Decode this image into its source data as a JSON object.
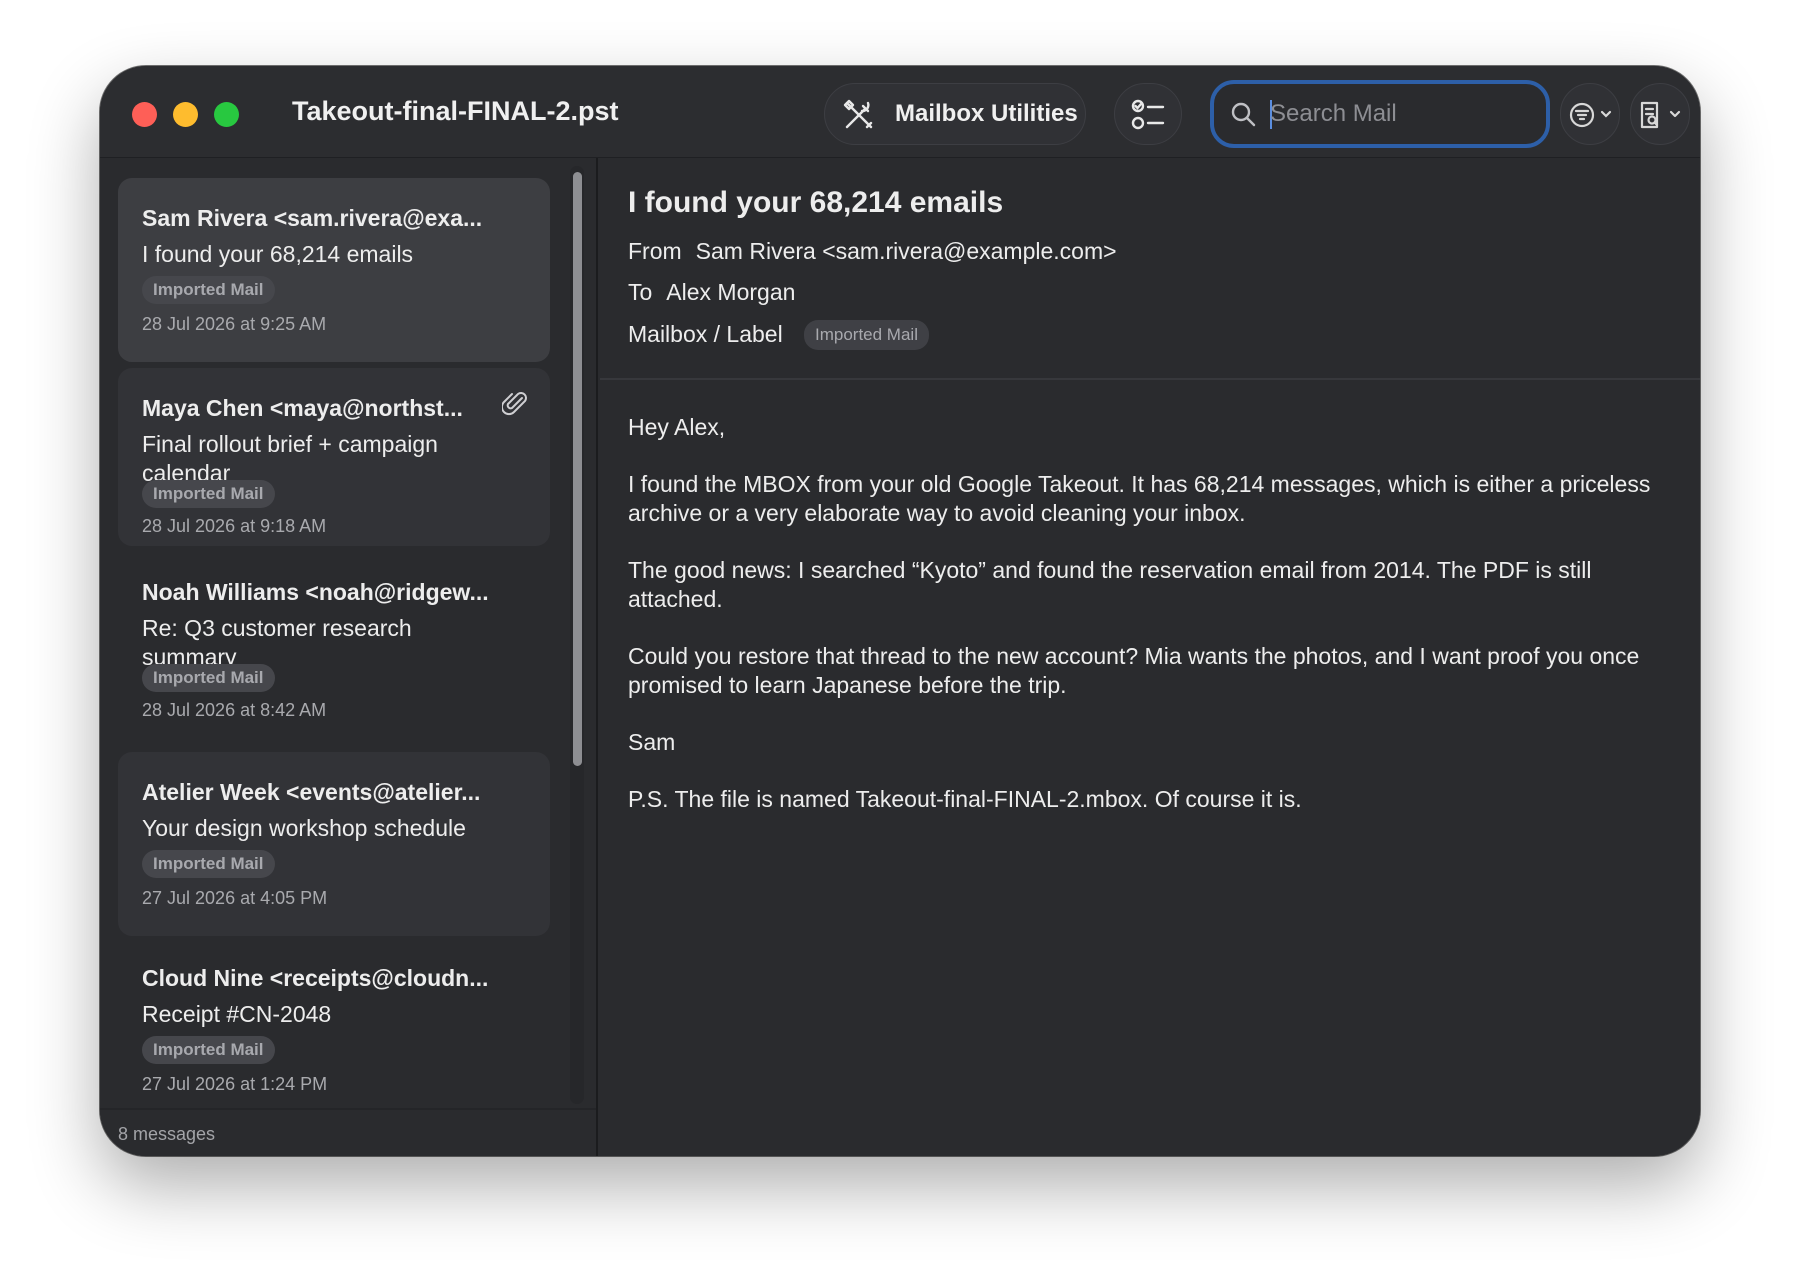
{
  "window": {
    "title": "Takeout-final-FINAL-2.pst"
  },
  "toolbar": {
    "utilities_label": "Mailbox Utilities",
    "utilities_icon": "tools-icon",
    "list_icon": "checklist-icon",
    "search_placeholder": "Search Mail",
    "search_value": "",
    "filter_icon": "filter-icon",
    "view_icon": "view-options-icon"
  },
  "colors": {
    "close": "#fe5f57",
    "minimize": "#febc2e",
    "zoom": "#28c840",
    "search_focus": "#2d5fa8"
  },
  "messages": [
    {
      "sender": "Sam Rivera <sam.rivera@exa...",
      "subject": "I found your 68,214 emails",
      "tag": "Imported Mail",
      "date": "28 Jul 2026 at 9:25 AM",
      "selected": true,
      "attachment": false
    },
    {
      "sender": "Maya Chen <maya@northst...",
      "subject": "Final rollout brief + campaign calendar",
      "tag": "Imported Mail",
      "date": "28 Jul 2026 at 9:18 AM",
      "selected": false,
      "attachment": true
    },
    {
      "sender": "Noah Williams <noah@ridgew...",
      "subject": "Re: Q3 customer research summary",
      "tag": "Imported Mail",
      "date": "28 Jul 2026 at 8:42 AM",
      "selected": false,
      "attachment": false
    },
    {
      "sender": "Atelier Week <events@atelier...",
      "subject": "Your design workshop schedule",
      "tag": "Imported Mail",
      "date": "27 Jul 2026 at 4:05 PM",
      "selected": false,
      "attachment": false
    },
    {
      "sender": "Cloud Nine <receipts@cloudn...",
      "subject": "Receipt #CN-2048",
      "tag": "Imported Mail",
      "date": "27 Jul 2026 at 1:24 PM",
      "selected": false,
      "attachment": false
    }
  ],
  "sidebar_footer": {
    "count_label": "8 messages"
  },
  "reader": {
    "subject": "I found your 68,214 emails",
    "from_label": "From",
    "from_value": "Sam Rivera <sam.rivera@example.com>",
    "to_label": "To",
    "to_value": "Alex Morgan",
    "mailbox_label": "Mailbox / Label",
    "mailbox_tag": "Imported Mail",
    "body": [
      "Hey Alex,",
      "I found the MBOX from your old Google Takeout. It has 68,214 messages, which is either a priceless archive or a very elaborate way to avoid cleaning your inbox.",
      "The good news: I searched “Kyoto” and found the reservation email from 2014. The PDF is still attached.",
      "Could you restore that thread to the new account? Mia wants the photos, and I want proof you once promised to learn Japanese before the trip.",
      "Sam",
      "P.S. The file is named Takeout-final-FINAL-2.mbox. Of course it is."
    ]
  }
}
